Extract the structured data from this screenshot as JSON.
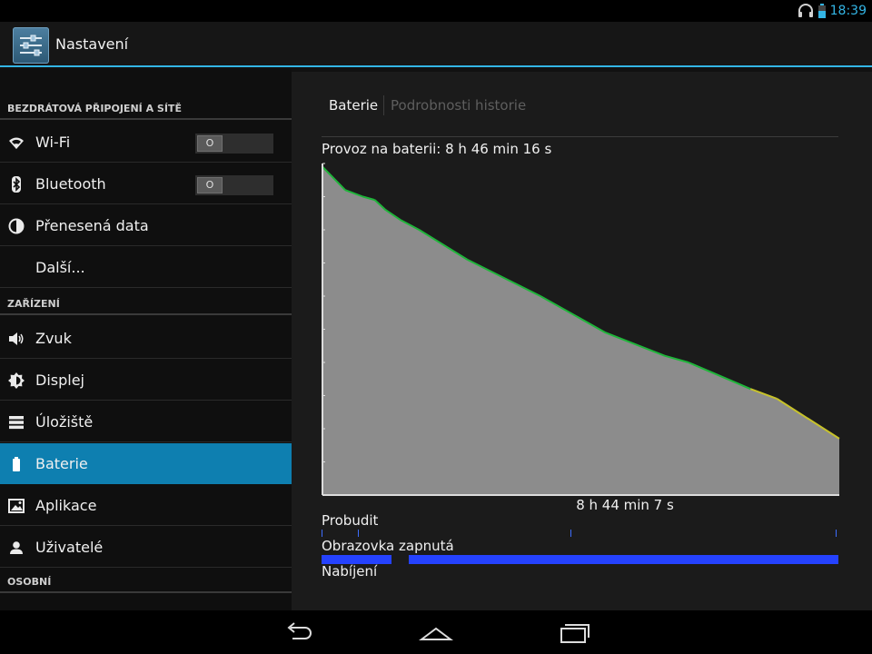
{
  "status_bar": {
    "time": "18:39",
    "icons": [
      "headset-icon",
      "battery-icon"
    ]
  },
  "action_bar": {
    "title": "Nastavení",
    "icon": "settings-sliders-icon"
  },
  "sidebar": {
    "sections": [
      {
        "header": "BEZDRÁTOVÁ PŘIPOJENÍ A SÍTĚ",
        "items": [
          {
            "label": "Wi-Fi",
            "icon": "wifi-icon",
            "toggle": "O"
          },
          {
            "label": "Bluetooth",
            "icon": "bluetooth-icon",
            "toggle": "O"
          },
          {
            "label": "Přenesená data",
            "icon": "data-usage-icon"
          },
          {
            "label": "Další..."
          }
        ]
      },
      {
        "header": "ZAŘÍZENÍ",
        "items": [
          {
            "label": "Zvuk",
            "icon": "speaker-icon"
          },
          {
            "label": "Displej",
            "icon": "brightness-icon"
          },
          {
            "label": "Úložiště",
            "icon": "storage-icon"
          },
          {
            "label": "Baterie",
            "icon": "battery-icon",
            "selected": true
          },
          {
            "label": "Aplikace",
            "icon": "apps-icon"
          },
          {
            "label": "Uživatelé",
            "icon": "user-icon"
          }
        ]
      },
      {
        "header": "OSOBNÍ",
        "items": []
      }
    ]
  },
  "content": {
    "tabs": [
      {
        "label": "Baterie",
        "active": true
      },
      {
        "label": "Podrobnosti historie",
        "active": false
      }
    ],
    "summary": "Provoz na baterii: 8 h 46 min 16 s",
    "duration": "8 h 44 min 7 s",
    "rows": {
      "awake": "Probudit",
      "screen_on": "Obrazovka zapnutá",
      "charging": "Nabíjení"
    },
    "screen_on_periods_fraction": [
      [
        0.0,
        0.135
      ],
      [
        0.168,
        1.0
      ]
    ],
    "awake_ticks_fraction": [
      0.0,
      0.07,
      0.483,
      0.998
    ]
  },
  "chart_data": {
    "type": "area",
    "title": "",
    "xlabel": "",
    "ylabel": "",
    "x_unit": "minutes on battery",
    "xlim": [
      0,
      524
    ],
    "ylim": [
      0,
      100
    ],
    "colors": {
      "fill": "#8c8c8c",
      "line_ok": "#1fb53a",
      "line_low": "#c7c22a"
    },
    "low_threshold": 30,
    "series": [
      {
        "x": [
          0,
          23,
          41,
          53,
          64,
          79,
          98,
          147,
          221,
          287,
          347,
          371,
          434,
          461,
          524
        ],
        "y": [
          99,
          92,
          90,
          89,
          86,
          83,
          80,
          71,
          60,
          49,
          42,
          40,
          32,
          29,
          17
        ]
      }
    ]
  },
  "navigation": {
    "buttons": [
      "back-icon",
      "home-icon",
      "recent-apps-icon"
    ]
  }
}
